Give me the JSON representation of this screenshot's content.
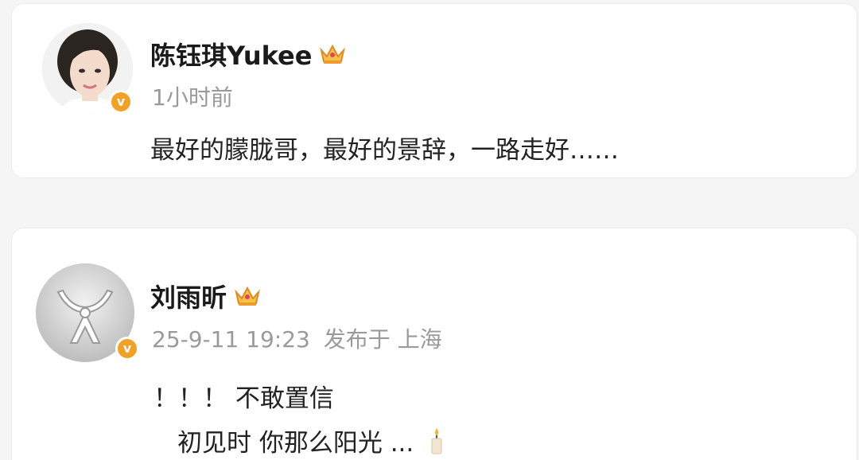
{
  "posts": [
    {
      "name": "陈钰琪Yukee",
      "meta": {
        "time": "1小时前"
      },
      "content": "最好的朦胧哥，最好的景辞，一路走好……",
      "verified_color": "#f3a125"
    },
    {
      "name": "刘雨昕",
      "meta": {
        "time": "25-9-11 19:23",
        "location": "发布于 上海"
      },
      "content_lines": [
        "！！！ 不敢置信",
        "初见时 你那么阳光 ..."
      ],
      "verified_color": "#f3a125"
    }
  ],
  "icons": {
    "crown": "crown-icon",
    "verified": "verified-v-icon",
    "candle": "candle-icon"
  },
  "verified_glyph": "v"
}
